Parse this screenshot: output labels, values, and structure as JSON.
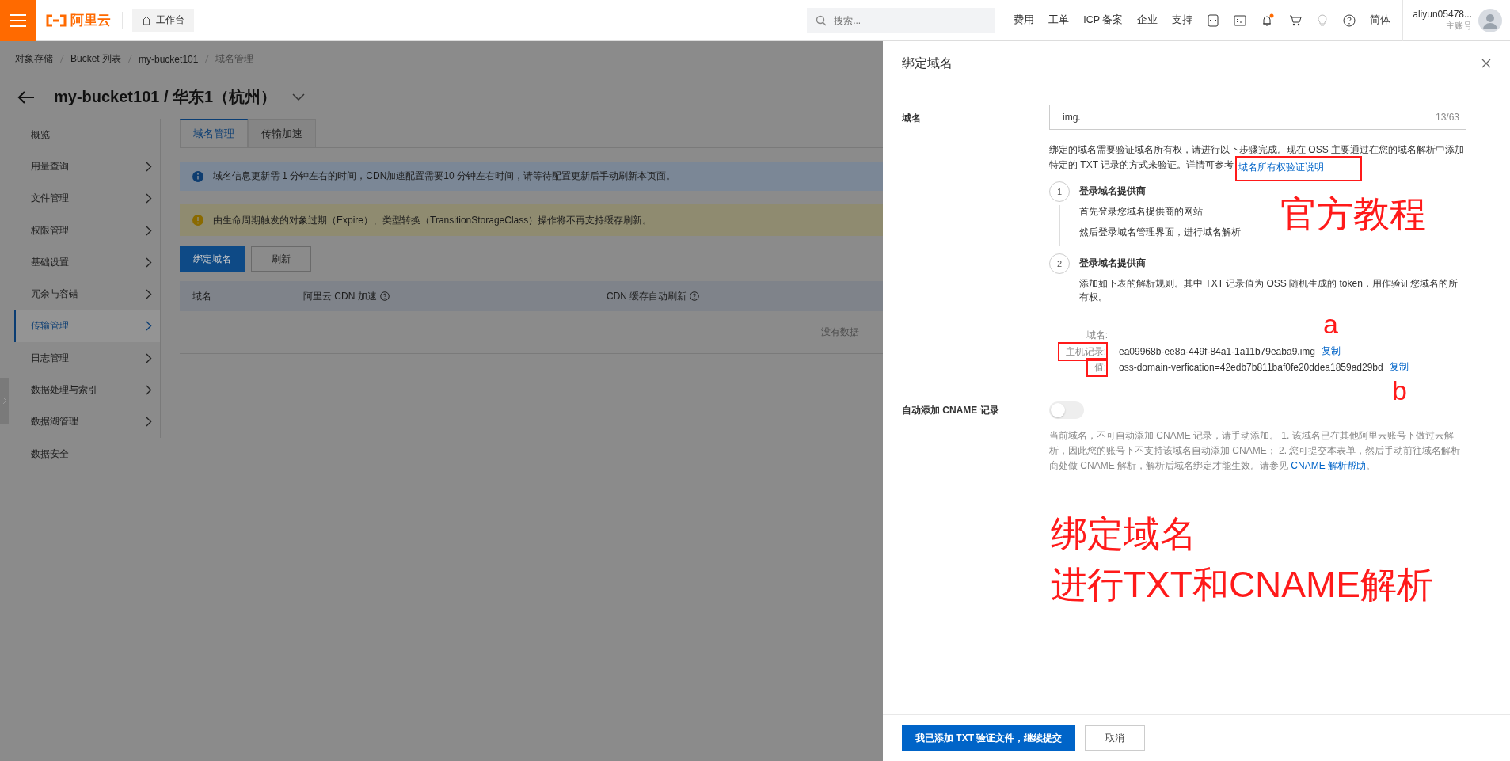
{
  "topbar": {
    "logo": "阿里云",
    "workbench": "工作台",
    "search": {
      "placeholder": "搜索..."
    },
    "nav": [
      "费用",
      "工单",
      "ICP 备案",
      "企业",
      "支持"
    ],
    "notification_dot": true,
    "language": "简体",
    "user": {
      "name": "aliyun05478...",
      "role": "主账号"
    }
  },
  "breadcrumb": [
    "对象存储",
    "Bucket 列表",
    "my-bucket101",
    "域名管理"
  ],
  "page_title": "my-bucket101 / 华东1（杭州）",
  "sidebar": {
    "items": [
      {
        "label": "概览",
        "has_children": false,
        "selected": false
      },
      {
        "label": "用量查询",
        "has_children": true,
        "selected": false
      },
      {
        "label": "文件管理",
        "has_children": true,
        "selected": false
      },
      {
        "label": "权限管理",
        "has_children": true,
        "selected": false
      },
      {
        "label": "基础设置",
        "has_children": true,
        "selected": false
      },
      {
        "label": "冗余与容错",
        "has_children": true,
        "selected": false
      },
      {
        "label": "传输管理",
        "has_children": true,
        "selected": true
      },
      {
        "label": "日志管理",
        "has_children": true,
        "selected": false
      },
      {
        "label": "数据处理与索引",
        "has_children": true,
        "selected": false
      },
      {
        "label": "数据湖管理",
        "has_children": true,
        "selected": false
      },
      {
        "label": "数据安全",
        "has_children": false,
        "selected": false
      }
    ]
  },
  "tabs": [
    {
      "label": "域名管理",
      "selected": true
    },
    {
      "label": "传输加速",
      "selected": false
    }
  ],
  "alerts": [
    {
      "kind": "info",
      "text": "域名信息更新需 1 分钟左右的时间，CDN加速配置需要10 分钟左右时间，请等待配置更新后手动刷新本页面。"
    },
    {
      "kind": "warning",
      "text": "由生命周期触发的对象过期（Expire）、类型转换（TransitionStorageClass）操作将不再支持缓存刷新。"
    }
  ],
  "actions": [
    {
      "label": "绑定域名",
      "kind": "primary"
    },
    {
      "label": "刷新",
      "kind": "normal"
    }
  ],
  "table": {
    "columns": [
      {
        "label": "域名",
        "help": false
      },
      {
        "label": "阿里云 CDN 加速",
        "help": true
      },
      {
        "label": "CDN 缓存自动刷新",
        "help": true
      }
    ],
    "empty_text": "没有数据"
  },
  "drawer": {
    "title": "绑定域名",
    "domain": {
      "label": "域名",
      "value": "img.",
      "count": "13/63"
    },
    "description": "绑定的域名需要验证域名所有权，请进行以下步骤完成。现在 OSS 主要通过在您的域名解析中添加特定的 TXT 记录的方式来验证。详情可参考",
    "description_link": "域名所有权验证说明",
    "steps": [
      {
        "number": "1",
        "title": "登录域名提供商",
        "lines": [
          "首先登录您域名提供商的网站",
          "然后登录域名管理界面，进行域名解析"
        ]
      },
      {
        "number": "2",
        "title": "登录域名提供商",
        "lines": [
          "添加如下表的解析规则。其中 TXT 记录值为 OSS 随机生成的 token，用作验证您域名的所有权。"
        ]
      }
    ],
    "records": [
      {
        "label": "域名:"
      },
      {
        "label": "主机记录:",
        "value": "ea09968b-ee8a-449f-84a1-1a11b79eaba9.img",
        "copy": "复制"
      },
      {
        "label": "值:",
        "value": "oss-domain-verfication=42edb7b811baf0fe20ddea1859ad29bd",
        "copy": "复制"
      }
    ],
    "cname": {
      "label": "自动添加 CNAME 记录",
      "on": false,
      "help": "当前域名，不可自动添加 CNAME 记录，请手动添加。 1. 该域名已在其他阿里云账号下做过云解析，因此您的账号下不支持该域名自动添加 CNAME； 2. 您可提交本表单，然后手动前往域名解析商处做 CNAME 解析，解析后域名绑定才能生效。请参见 ",
      "help_link": "CNAME 解析帮助",
      "help_end": "。"
    },
    "buttons": [
      {
        "label": "我已添加 TXT 验证文件，继续提交",
        "kind": "primary"
      },
      {
        "label": "取消",
        "kind": "normal"
      }
    ]
  },
  "annotations": [
    "官方教程",
    "a",
    "b",
    "绑定域名",
    "进行TXT和CNAME解析"
  ]
}
